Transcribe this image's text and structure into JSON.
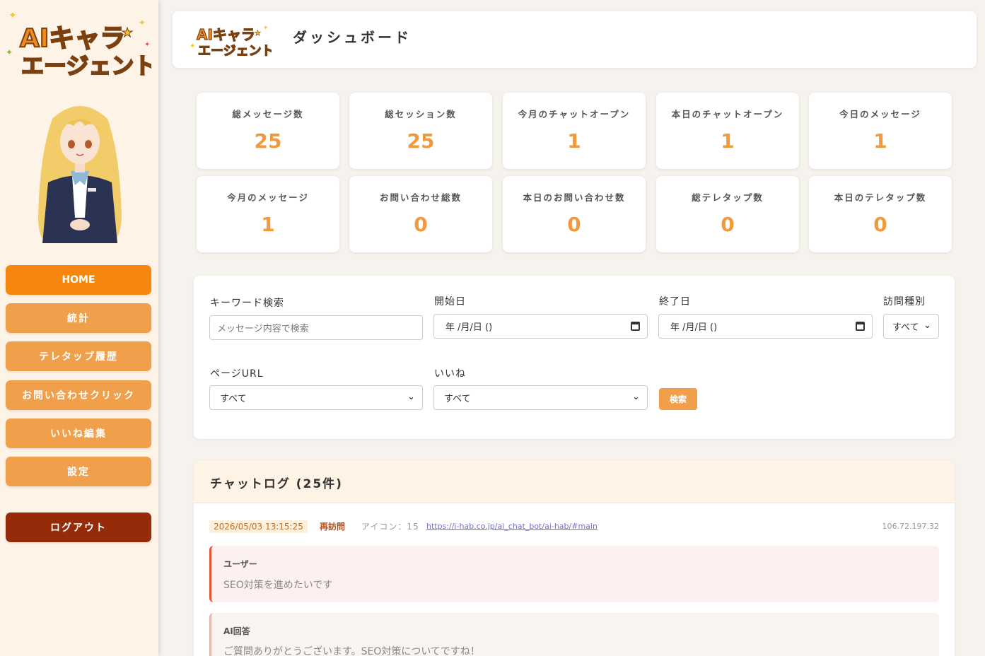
{
  "brand": {
    "logo_text_line1": "AIキャラ",
    "logo_text_line2": "エージェント"
  },
  "sidebar": {
    "items": [
      {
        "label": "HOME"
      },
      {
        "label": "統計"
      },
      {
        "label": "テレタップ履歴"
      },
      {
        "label": "お問い合わせクリック"
      },
      {
        "label": "いいね編集"
      },
      {
        "label": "設定"
      }
    ],
    "logout_label": "ログアウト"
  },
  "header": {
    "title": "ダッシュボード"
  },
  "stats": [
    {
      "label": "総メッセージ数",
      "value": "25"
    },
    {
      "label": "総セッション数",
      "value": "25"
    },
    {
      "label": "今月のチャットオープン",
      "value": "1"
    },
    {
      "label": "本日のチャットオープン",
      "value": "1"
    },
    {
      "label": "今日のメッセージ",
      "value": "1"
    },
    {
      "label": "今月のメッセージ",
      "value": "1"
    },
    {
      "label": "お問い合わせ総数",
      "value": "0"
    },
    {
      "label": "本日のお問い合わせ数",
      "value": "0"
    },
    {
      "label": "総テレタップ数",
      "value": "0"
    },
    {
      "label": "本日のテレタップ数",
      "value": "0"
    }
  ],
  "filter": {
    "keyword_label": "キーワード検索",
    "keyword_placeholder": "メッセージ内容で検索",
    "start_label": "開始日",
    "start_value": "年 /月/日 ()",
    "end_label": "終了日",
    "end_value": "年 /月/日 ()",
    "visit_label": "訪問種別",
    "visit_value": "すべて",
    "page_url_label": "ページURL",
    "page_url_value": "すべて",
    "like_label": "いいね",
    "like_value": "すべて",
    "search_button": "検索"
  },
  "chat_log": {
    "title": "チャットログ (25件)",
    "entry": {
      "timestamp": "2026/05/03 13:15:25",
      "visit_type": "再訪問",
      "icon": "アイコン：15",
      "url": "https://i-hab.co.jp/ai_chat_bot/ai-hab/#main",
      "ip": "106.72.197.32",
      "user_label": "ユーザー",
      "user_text": "SEO対策を進めたいです",
      "ai_label": "AI回答",
      "ai_text": "ご質問ありがとうございます。SEO対策についてですね！"
    }
  },
  "colors": {
    "accent": "#f0a04b",
    "active": "#f5870f",
    "logout": "#952b09",
    "stat_value": "#ef9a3c",
    "sidebar_bg": "#fdf3e7"
  }
}
